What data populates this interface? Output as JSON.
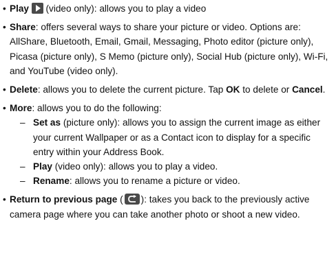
{
  "bullet_char": "•",
  "dash_char": "–",
  "items": [
    {
      "term": "Play",
      "icon": "play-icon",
      "text_after_icon": " (video only): allows you to play a video"
    },
    {
      "term": "Share",
      "text": ": offers several ways to share your picture or video. Options are: AllShare, Bluetooth, Email, Gmail, Messaging, Photo editor (picture only), Picasa (picture only), S Memo (picture only), Social Hub (picture only), Wi-Fi, and YouTube (video only)."
    },
    {
      "term": "Delete",
      "text_a": ": allows you to delete the current picture. Tap ",
      "ok": "OK",
      "text_b": " to delete or ",
      "cancel": "Cancel",
      "text_c": "."
    },
    {
      "term": "More",
      "text": ": allows you to do the following:",
      "subitems": [
        {
          "term": "Set as",
          "text": " (picture only): allows you to assign the current image as either your current Wallpaper or as a Contact icon to display for a specific entry within your Address Book."
        },
        {
          "term": "Play",
          "text": " (video only): allows you to play a video."
        },
        {
          "term": "Rename",
          "text": ": allows you to rename a picture or video."
        }
      ]
    },
    {
      "term": "Return to previous page",
      "text_before_icon": " (",
      "icon": "return-icon",
      "text_after_icon": "): takes you back to the previously active camera page where you can take another photo or shoot a new video."
    }
  ]
}
